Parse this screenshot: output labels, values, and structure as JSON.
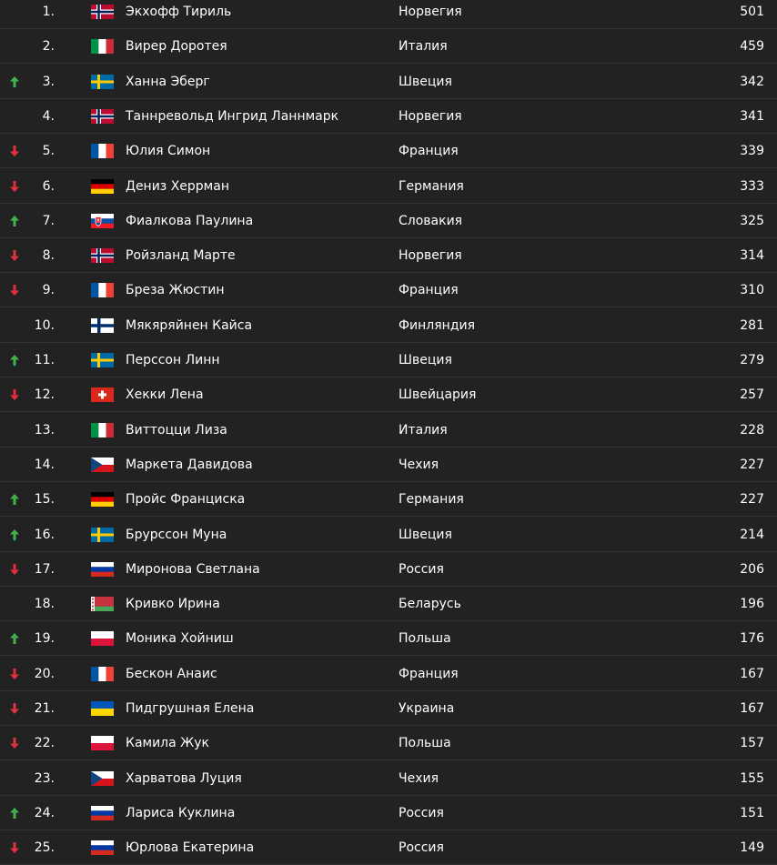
{
  "colors": {
    "background": "#222222",
    "row_divider": "#333333",
    "text": "#ffffff",
    "trend_up": "#3fb34f",
    "trend_down": "#e0303d"
  },
  "standings": [
    {
      "trend": "",
      "rank": "1.",
      "flag": "norway-flag",
      "name": "Экхофф Тириль",
      "country": "Норвегия",
      "points": "501"
    },
    {
      "trend": "",
      "rank": "2.",
      "flag": "italy-flag",
      "name": "Вирер Доротея",
      "country": "Италия",
      "points": "459"
    },
    {
      "trend": "up",
      "rank": "3.",
      "flag": "sweden-flag",
      "name": "Ханна Эберг",
      "country": "Швеция",
      "points": "342"
    },
    {
      "trend": "",
      "rank": "4.",
      "flag": "norway-flag",
      "name": "Таннревольд Ингрид Ланнмарк",
      "country": "Норвегия",
      "points": "341"
    },
    {
      "trend": "down",
      "rank": "5.",
      "flag": "france-flag",
      "name": "Юлия Симон",
      "country": "Франция",
      "points": "339"
    },
    {
      "trend": "down",
      "rank": "6.",
      "flag": "germany-flag",
      "name": "Дениз Херрман",
      "country": "Германия",
      "points": "333"
    },
    {
      "trend": "up",
      "rank": "7.",
      "flag": "slovakia-flag",
      "name": "Фиалкова Паулина",
      "country": "Словакия",
      "points": "325"
    },
    {
      "trend": "down",
      "rank": "8.",
      "flag": "norway-flag",
      "name": "Ройзланд Марте",
      "country": "Норвегия",
      "points": "314"
    },
    {
      "trend": "down",
      "rank": "9.",
      "flag": "france-flag",
      "name": "Бреза Жюстин",
      "country": "Франция",
      "points": "310"
    },
    {
      "trend": "",
      "rank": "10.",
      "flag": "finland-flag",
      "name": "Мякяряйнен Кайса",
      "country": "Финляндия",
      "points": "281"
    },
    {
      "trend": "up",
      "rank": "11.",
      "flag": "sweden-flag",
      "name": "Перссон Линн",
      "country": "Швеция",
      "points": "279"
    },
    {
      "trend": "down",
      "rank": "12.",
      "flag": "switzerland-flag",
      "name": "Хекки Лена",
      "country": "Швейцария",
      "points": "257"
    },
    {
      "trend": "",
      "rank": "13.",
      "flag": "italy-flag",
      "name": "Виттоцци Лиза",
      "country": "Италия",
      "points": "228"
    },
    {
      "trend": "",
      "rank": "14.",
      "flag": "czechia-flag",
      "name": "Маркета Давидова",
      "country": "Чехия",
      "points": "227"
    },
    {
      "trend": "up",
      "rank": "15.",
      "flag": "germany-flag",
      "name": "Пройс Франциска",
      "country": "Германия",
      "points": "227"
    },
    {
      "trend": "up",
      "rank": "16.",
      "flag": "sweden-flag",
      "name": "Брурссон Муна",
      "country": "Швеция",
      "points": "214"
    },
    {
      "trend": "down",
      "rank": "17.",
      "flag": "russia-flag",
      "name": "Миронова Светлана",
      "country": "Россия",
      "points": "206"
    },
    {
      "trend": "",
      "rank": "18.",
      "flag": "belarus-flag",
      "name": "Кривко Ирина",
      "country": "Беларусь",
      "points": "196"
    },
    {
      "trend": "up",
      "rank": "19.",
      "flag": "poland-flag",
      "name": "Моника Хойниш",
      "country": "Польша",
      "points": "176"
    },
    {
      "trend": "down",
      "rank": "20.",
      "flag": "france-flag",
      "name": "Бескон Анаис",
      "country": "Франция",
      "points": "167"
    },
    {
      "trend": "down",
      "rank": "21.",
      "flag": "ukraine-flag",
      "name": "Пидгрушная Елена",
      "country": "Украина",
      "points": "167"
    },
    {
      "trend": "down",
      "rank": "22.",
      "flag": "poland-flag",
      "name": "Камила Жук",
      "country": "Польша",
      "points": "157"
    },
    {
      "trend": "",
      "rank": "23.",
      "flag": "czechia-flag",
      "name": "Харватова Луция",
      "country": "Чехия",
      "points": "155"
    },
    {
      "trend": "up",
      "rank": "24.",
      "flag": "russia-flag",
      "name": "Лариса Куклина",
      "country": "Россия",
      "points": "151"
    },
    {
      "trend": "down",
      "rank": "25.",
      "flag": "russia-flag",
      "name": "Юрлова Екатерина",
      "country": "Россия",
      "points": "149"
    }
  ]
}
